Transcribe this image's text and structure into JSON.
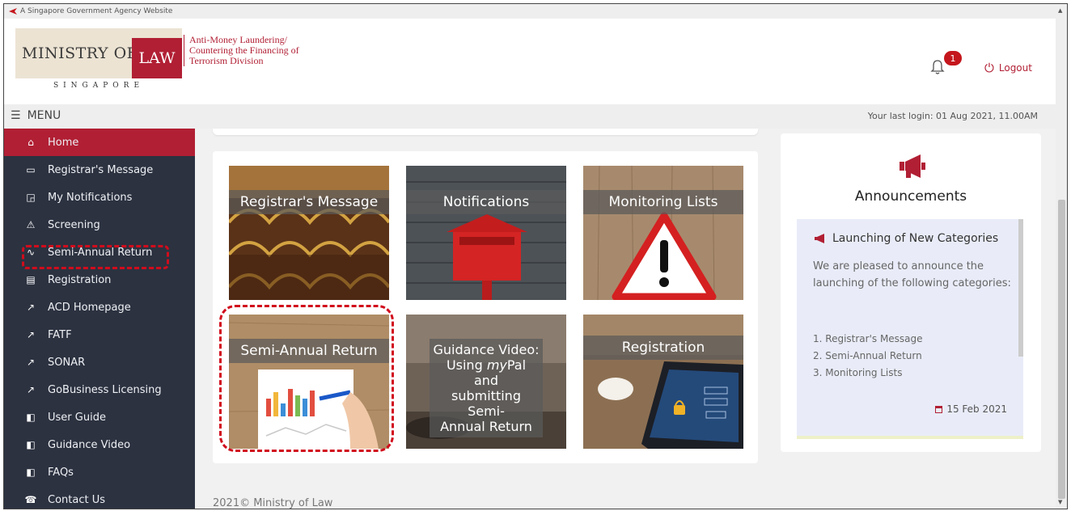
{
  "gov_banner": "A Singapore Government Agency Website",
  "header": {
    "logo": {
      "ministry": "MINISTRY OF",
      "law": "LAW",
      "country": "SINGAPORE"
    },
    "division_lines": [
      "Anti-Money Laundering/",
      "Countering the Financing of",
      "Terrorism Division"
    ],
    "notification_count": "1",
    "logout_label": "Logout"
  },
  "menubar": {
    "menu_label": "MENU",
    "last_login": "Your last login: 01 Aug 2021, 11.00AM"
  },
  "sidebar": {
    "items": [
      {
        "label": "Home",
        "icon": "home-icon",
        "active": true
      },
      {
        "label": "Registrar's Message",
        "icon": "message-icon"
      },
      {
        "label": "My Notifications",
        "icon": "notification-icon"
      },
      {
        "label": "Screening",
        "icon": "warning-icon"
      },
      {
        "label": "Semi-Annual Return",
        "icon": "chart-icon"
      },
      {
        "label": "Registration",
        "icon": "registration-icon"
      },
      {
        "label": "ACD Homepage",
        "icon": "external-link-icon"
      },
      {
        "label": "FATF",
        "icon": "external-link-icon"
      },
      {
        "label": "SONAR",
        "icon": "external-link-icon"
      },
      {
        "label": "GoBusiness Licensing",
        "icon": "external-link-icon"
      },
      {
        "label": "User Guide",
        "icon": "book-icon"
      },
      {
        "label": "Guidance Video",
        "icon": "book-icon"
      },
      {
        "label": "FAQs",
        "icon": "book-icon"
      },
      {
        "label": "Contact Us",
        "icon": "contact-icon"
      }
    ]
  },
  "tiles": [
    {
      "label": "Registrar's Message"
    },
    {
      "label": "Notifications"
    },
    {
      "label": "Monitoring Lists"
    },
    {
      "label": "Semi-Annual Return"
    },
    {
      "label_parts": [
        "Guidance Video:",
        "Using ",
        "my",
        "Pal and",
        "submitting Semi-",
        "Annual Return"
      ]
    },
    {
      "label": "Registration"
    }
  ],
  "announcements": {
    "title": "Announcements",
    "item_title": "Launching of New Categories",
    "body": "We are pleased to announce the launching of the following categories:",
    "list": [
      "1. Registrar's Message",
      "2. Semi-Annual Return",
      "3. Monitoring Lists"
    ],
    "date": "15 Feb 2021"
  },
  "footer": "2021© Ministry of Law",
  "colors": {
    "brand_red": "#b11f34",
    "sidebar_bg": "#2c3240",
    "highlight": "#d10c1c"
  }
}
